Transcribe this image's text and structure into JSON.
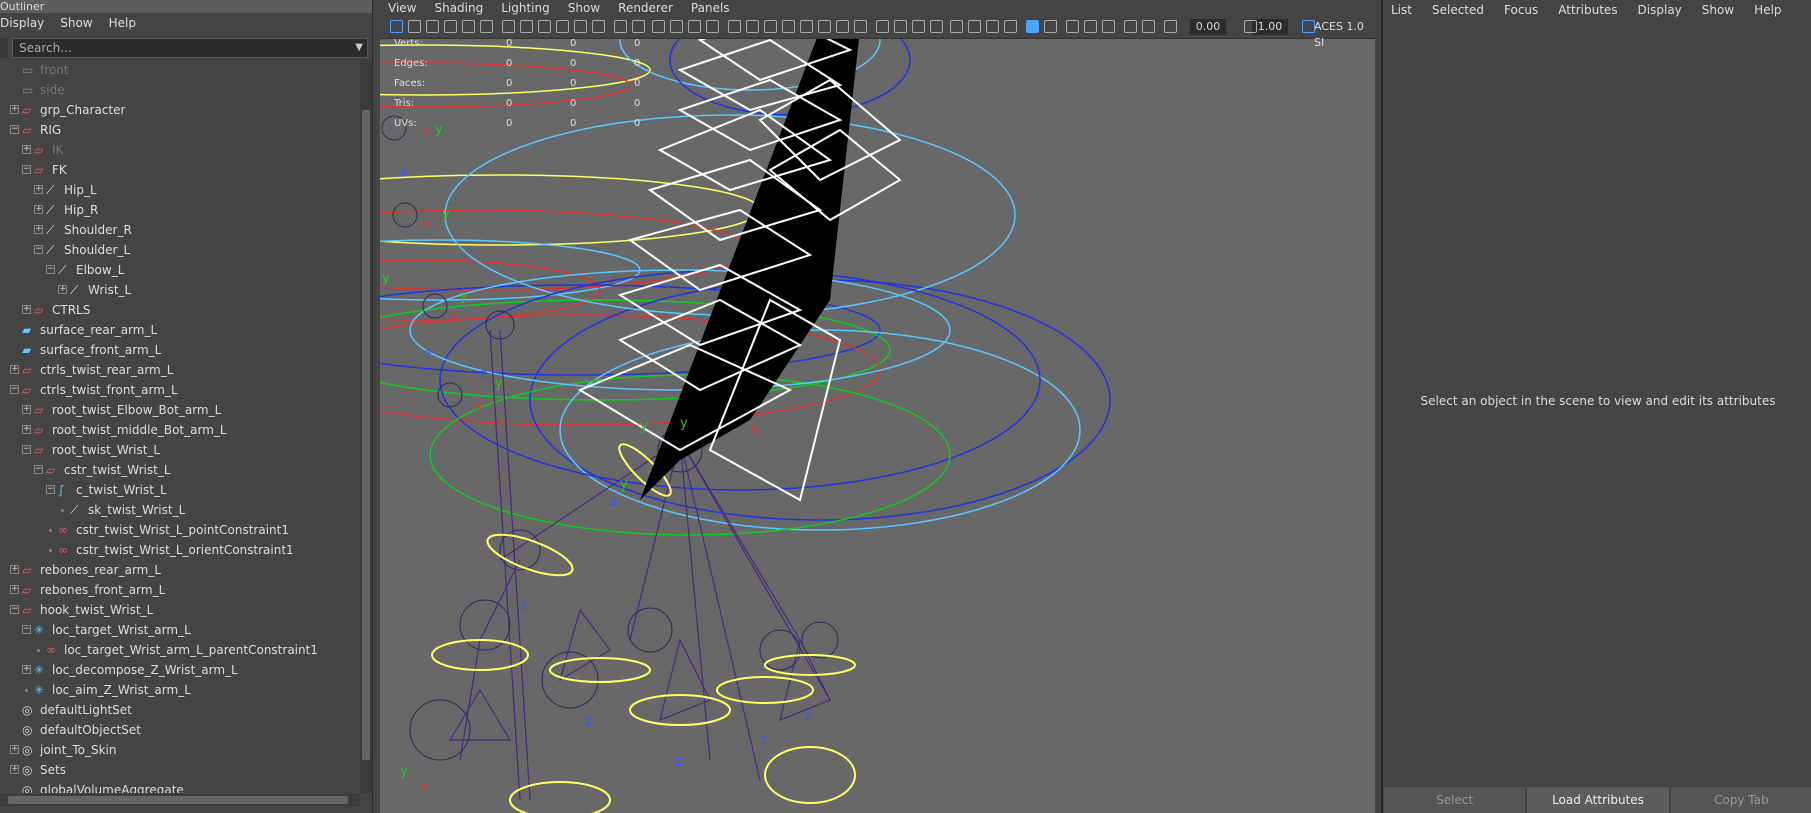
{
  "outliner": {
    "title": "Outliner",
    "menu": [
      "Display",
      "Show",
      "Help"
    ],
    "search_placeholder": "Search...",
    "items": [
      {
        "label": "front",
        "depth": 1,
        "expander": "",
        "icon": "camera",
        "dim": true
      },
      {
        "label": "side",
        "depth": 1,
        "expander": "",
        "icon": "camera",
        "dim": true
      },
      {
        "label": "grp_Character",
        "depth": 1,
        "expander": "+",
        "icon": "group"
      },
      {
        "label": "RIG",
        "depth": 1,
        "expander": "-",
        "icon": "group"
      },
      {
        "label": "IK",
        "depth": 2,
        "expander": "+",
        "icon": "group",
        "dim": true
      },
      {
        "label": "FK",
        "depth": 2,
        "expander": "-",
        "icon": "group"
      },
      {
        "label": "Hip_L",
        "depth": 3,
        "expander": "+",
        "icon": "joint"
      },
      {
        "label": "Hip_R",
        "depth": 3,
        "expander": "+",
        "icon": "joint"
      },
      {
        "label": "Shoulder_R",
        "depth": 3,
        "expander": "+",
        "icon": "joint"
      },
      {
        "label": "Shoulder_L",
        "depth": 3,
        "expander": "-",
        "icon": "joint"
      },
      {
        "label": "Elbow_L",
        "depth": 4,
        "expander": "-",
        "icon": "joint"
      },
      {
        "label": "Wrist_L",
        "depth": 5,
        "expander": "+",
        "icon": "joint"
      },
      {
        "label": "CTRLS",
        "depth": 2,
        "expander": "+",
        "icon": "group"
      },
      {
        "label": "surface_rear_arm_L",
        "depth": 1,
        "expander": "",
        "icon": "surface"
      },
      {
        "label": "surface_front_arm_L",
        "depth": 1,
        "expander": "",
        "icon": "surface"
      },
      {
        "label": "ctrls_twist_rear_arm_L",
        "depth": 1,
        "expander": "+",
        "icon": "group"
      },
      {
        "label": "ctrls_twist_front_arm_L",
        "depth": 1,
        "expander": "-",
        "icon": "group"
      },
      {
        "label": "root_twist_Elbow_Bot_arm_L",
        "depth": 2,
        "expander": "+",
        "icon": "group"
      },
      {
        "label": "root_twist_middle_Bot_arm_L",
        "depth": 2,
        "expander": "+",
        "icon": "group"
      },
      {
        "label": "root_twist_Wrist_L",
        "depth": 2,
        "expander": "-",
        "icon": "group"
      },
      {
        "label": "cstr_twist_Wrist_L",
        "depth": 3,
        "expander": "-",
        "icon": "group"
      },
      {
        "label": "c_twist_Wrist_L",
        "depth": 4,
        "expander": "-",
        "icon": "curve"
      },
      {
        "label": "sk_twist_Wrist_L",
        "depth": 5,
        "expander": "dot",
        "icon": "joint"
      },
      {
        "label": "cstr_twist_Wrist_L_pointConstraint1",
        "depth": 4,
        "expander": "dot",
        "icon": "constraint"
      },
      {
        "label": "cstr_twist_Wrist_L_orientConstraint1",
        "depth": 4,
        "expander": "dot",
        "icon": "constraint"
      },
      {
        "label": "rebones_rear_arm_L",
        "depth": 1,
        "expander": "+",
        "icon": "group"
      },
      {
        "label": "rebones_front_arm_L",
        "depth": 1,
        "expander": "+",
        "icon": "group"
      },
      {
        "label": "hook_twist_Wrist_L",
        "depth": 1,
        "expander": "-",
        "icon": "group"
      },
      {
        "label": "loc_target_Wrist_arm_L",
        "depth": 2,
        "expander": "-",
        "icon": "locator"
      },
      {
        "label": "loc_target_Wrist_arm_L_parentConstraint1",
        "depth": 3,
        "expander": "dot",
        "icon": "constraint"
      },
      {
        "label": "loc_decompose_Z_Wrist_arm_L",
        "depth": 2,
        "expander": "+",
        "icon": "locator"
      },
      {
        "label": "loc_aim_Z_Wrist_arm_L",
        "depth": 2,
        "expander": "dot",
        "icon": "locator"
      },
      {
        "label": "defaultLightSet",
        "depth": 1,
        "expander": "",
        "icon": "set"
      },
      {
        "label": "defaultObjectSet",
        "depth": 1,
        "expander": "",
        "icon": "set"
      },
      {
        "label": "joint_To_Skin",
        "depth": 1,
        "expander": "+",
        "icon": "set"
      },
      {
        "label": "Sets",
        "depth": 1,
        "expander": "+",
        "icon": "set"
      },
      {
        "label": "globalVolumeAggregate",
        "depth": 1,
        "expander": "",
        "icon": "set"
      }
    ]
  },
  "viewport": {
    "menu": [
      "View",
      "Shading",
      "Lighting",
      "Show",
      "Renderer",
      "Panels"
    ],
    "field_a": "0.00",
    "field_b": "1.00",
    "colorspace": "ACES 1.0 SI",
    "stats": [
      {
        "label": "Verts:",
        "v1": "0",
        "v2": "0",
        "v3": "0"
      },
      {
        "label": "Edges:",
        "v1": "0",
        "v2": "0",
        "v3": "0"
      },
      {
        "label": "Faces:",
        "v1": "0",
        "v2": "0",
        "v3": "0"
      },
      {
        "label": "Tris:",
        "v1": "0",
        "v2": "0",
        "v3": "0"
      },
      {
        "label": "UVs:",
        "v1": "0",
        "v2": "0",
        "v3": "0"
      }
    ]
  },
  "attributes": {
    "menu": [
      "List",
      "Selected",
      "Focus",
      "Attributes",
      "Display",
      "Show",
      "Help"
    ],
    "message": "Select an object in the scene to view and edit its attributes",
    "buttons": {
      "select": "Select",
      "load": "Load Attributes",
      "copy": "Copy Tab"
    }
  }
}
